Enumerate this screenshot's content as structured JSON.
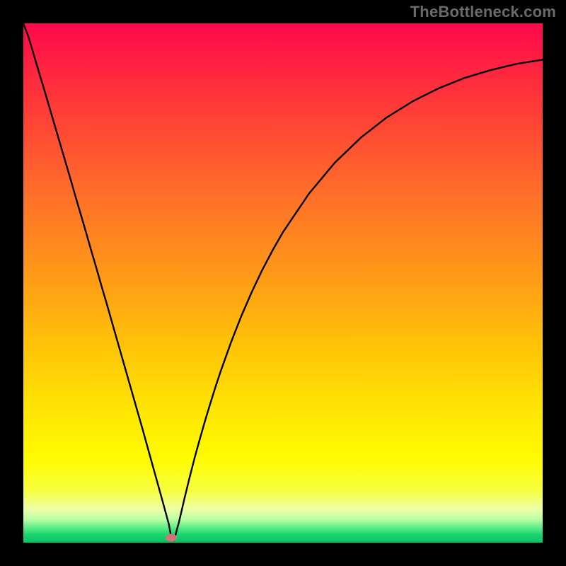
{
  "watermark": "TheBottleneck.com",
  "chart_data": {
    "type": "line",
    "title": "",
    "xlabel": "",
    "ylabel": "",
    "xlim": [
      0,
      100
    ],
    "ylim": [
      0,
      100
    ],
    "series": [
      {
        "name": "bottleneck-curve",
        "x": [
          0,
          1,
          2,
          3,
          4,
          5,
          6,
          7,
          8,
          9,
          10,
          11,
          12,
          13,
          14,
          15,
          16,
          17,
          18,
          19,
          20,
          21,
          22,
          23,
          24,
          25,
          26,
          27,
          28,
          28.5,
          29,
          30,
          31,
          32,
          33,
          34,
          35,
          36,
          37,
          38,
          40,
          42,
          44,
          46,
          48,
          50,
          55,
          60,
          65,
          70,
          75,
          80,
          85,
          90,
          95,
          100
        ],
        "values": [
          100,
          97.4,
          94.0,
          90.6,
          87.3,
          83.9,
          80.5,
          77.1,
          73.7,
          70.3,
          66.8,
          63.4,
          60.0,
          56.5,
          53.1,
          49.6,
          46.2,
          42.7,
          39.2,
          35.7,
          32.2,
          28.7,
          25.2,
          21.7,
          18.1,
          14.5,
          10.9,
          7.3,
          3.6,
          1.0,
          0.4,
          4.1,
          8.4,
          12.5,
          16.4,
          20.0,
          23.5,
          26.8,
          30.0,
          33.0,
          38.6,
          43.7,
          48.3,
          52.5,
          56.3,
          59.8,
          67.2,
          73.2,
          78.0,
          81.9,
          85.0,
          87.5,
          89.5,
          91.0,
          92.2,
          93.0
        ]
      }
    ],
    "marker": {
      "x": 28.5,
      "y": 1.0,
      "color": "#d27279"
    },
    "gradient_stops": [
      {
        "pos": 0.0,
        "color": "#ff094b"
      },
      {
        "pos": 0.16,
        "color": "#ff3b38"
      },
      {
        "pos": 0.33,
        "color": "#ff6f29"
      },
      {
        "pos": 0.49,
        "color": "#ff9b17"
      },
      {
        "pos": 0.62,
        "color": "#ffc308"
      },
      {
        "pos": 0.74,
        "color": "#ffe403"
      },
      {
        "pos": 0.84,
        "color": "#fffc02"
      },
      {
        "pos": 0.9,
        "color": "#f7ff3f"
      },
      {
        "pos": 0.935,
        "color": "#efffa7"
      },
      {
        "pos": 0.955,
        "color": "#baffa4"
      },
      {
        "pos": 0.97,
        "color": "#62ef89"
      },
      {
        "pos": 0.983,
        "color": "#1fd771"
      },
      {
        "pos": 1.0,
        "color": "#07c160"
      }
    ]
  }
}
